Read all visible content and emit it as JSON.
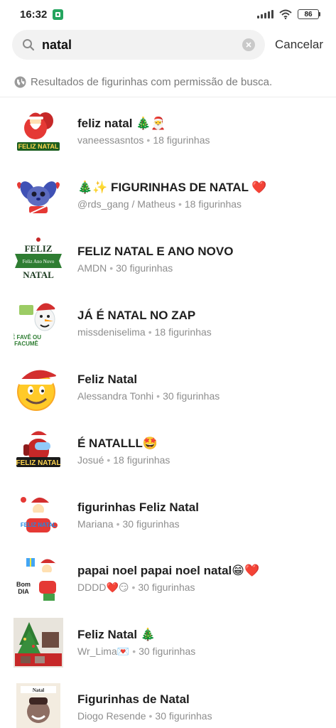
{
  "status_bar": {
    "time": "16:32",
    "battery": "86"
  },
  "search": {
    "query": "natal",
    "cancel_label": "Cancelar"
  },
  "notice": "Resultados de figurinhas com permissão de busca.",
  "results": [
    {
      "title": "feliz natal 🎄🎅",
      "author": "vaneessasntos",
      "count": "18 figurinhas",
      "thumb": "santa-feliz-natal-sticker"
    },
    {
      "title": "🎄✨ FIGURINHAS DE NATAL ❤️",
      "author": "@rds_gang / Matheus",
      "count": "18 figurinhas",
      "thumb": "stitch-christmas-sticker"
    },
    {
      "title": "FELIZ NATAL E ANO NOVO",
      "author": "AMDN",
      "count": "30 figurinhas",
      "thumb": "feliz-natal-banner-sticker"
    },
    {
      "title": "JÁ É NATAL NO ZAP",
      "author": "missdeniselima",
      "count": "18 figurinhas",
      "thumb": "olaf-christmas-sticker"
    },
    {
      "title": "Feliz Natal",
      "author": "Alessandra Tonhi",
      "count": "30 figurinhas",
      "thumb": "smiley-santa-hat-sticker"
    },
    {
      "title": "É NATALLL🤩",
      "author": "Josué",
      "count": "18 figurinhas",
      "thumb": "among-us-santa-sticker"
    },
    {
      "title": "figurinhas Feliz  Natal",
      "author": "Mariana",
      "count": "30 figurinhas",
      "thumb": "santa-claus-sticker"
    },
    {
      "title": "papai noel papai noel natal😁❤️",
      "author": "DDDD❤️😏",
      "count": "30 figurinhas",
      "thumb": "santa-bom-dia-sticker"
    },
    {
      "title": "Feliz Natal 🎄",
      "author": "Wr_Lima💌",
      "count": "30 figurinhas",
      "thumb": "christmas-photo-sticker"
    },
    {
      "title": "Figurinhas de Natal",
      "author": "Diogo Resende",
      "count": "30 figurinhas",
      "thumb": "man-christmas-photo-sticker"
    }
  ],
  "colors": {
    "accent_green": "#25a55f",
    "santa_red": "#d42a2a",
    "text_secondary": "#8e8e8e"
  }
}
